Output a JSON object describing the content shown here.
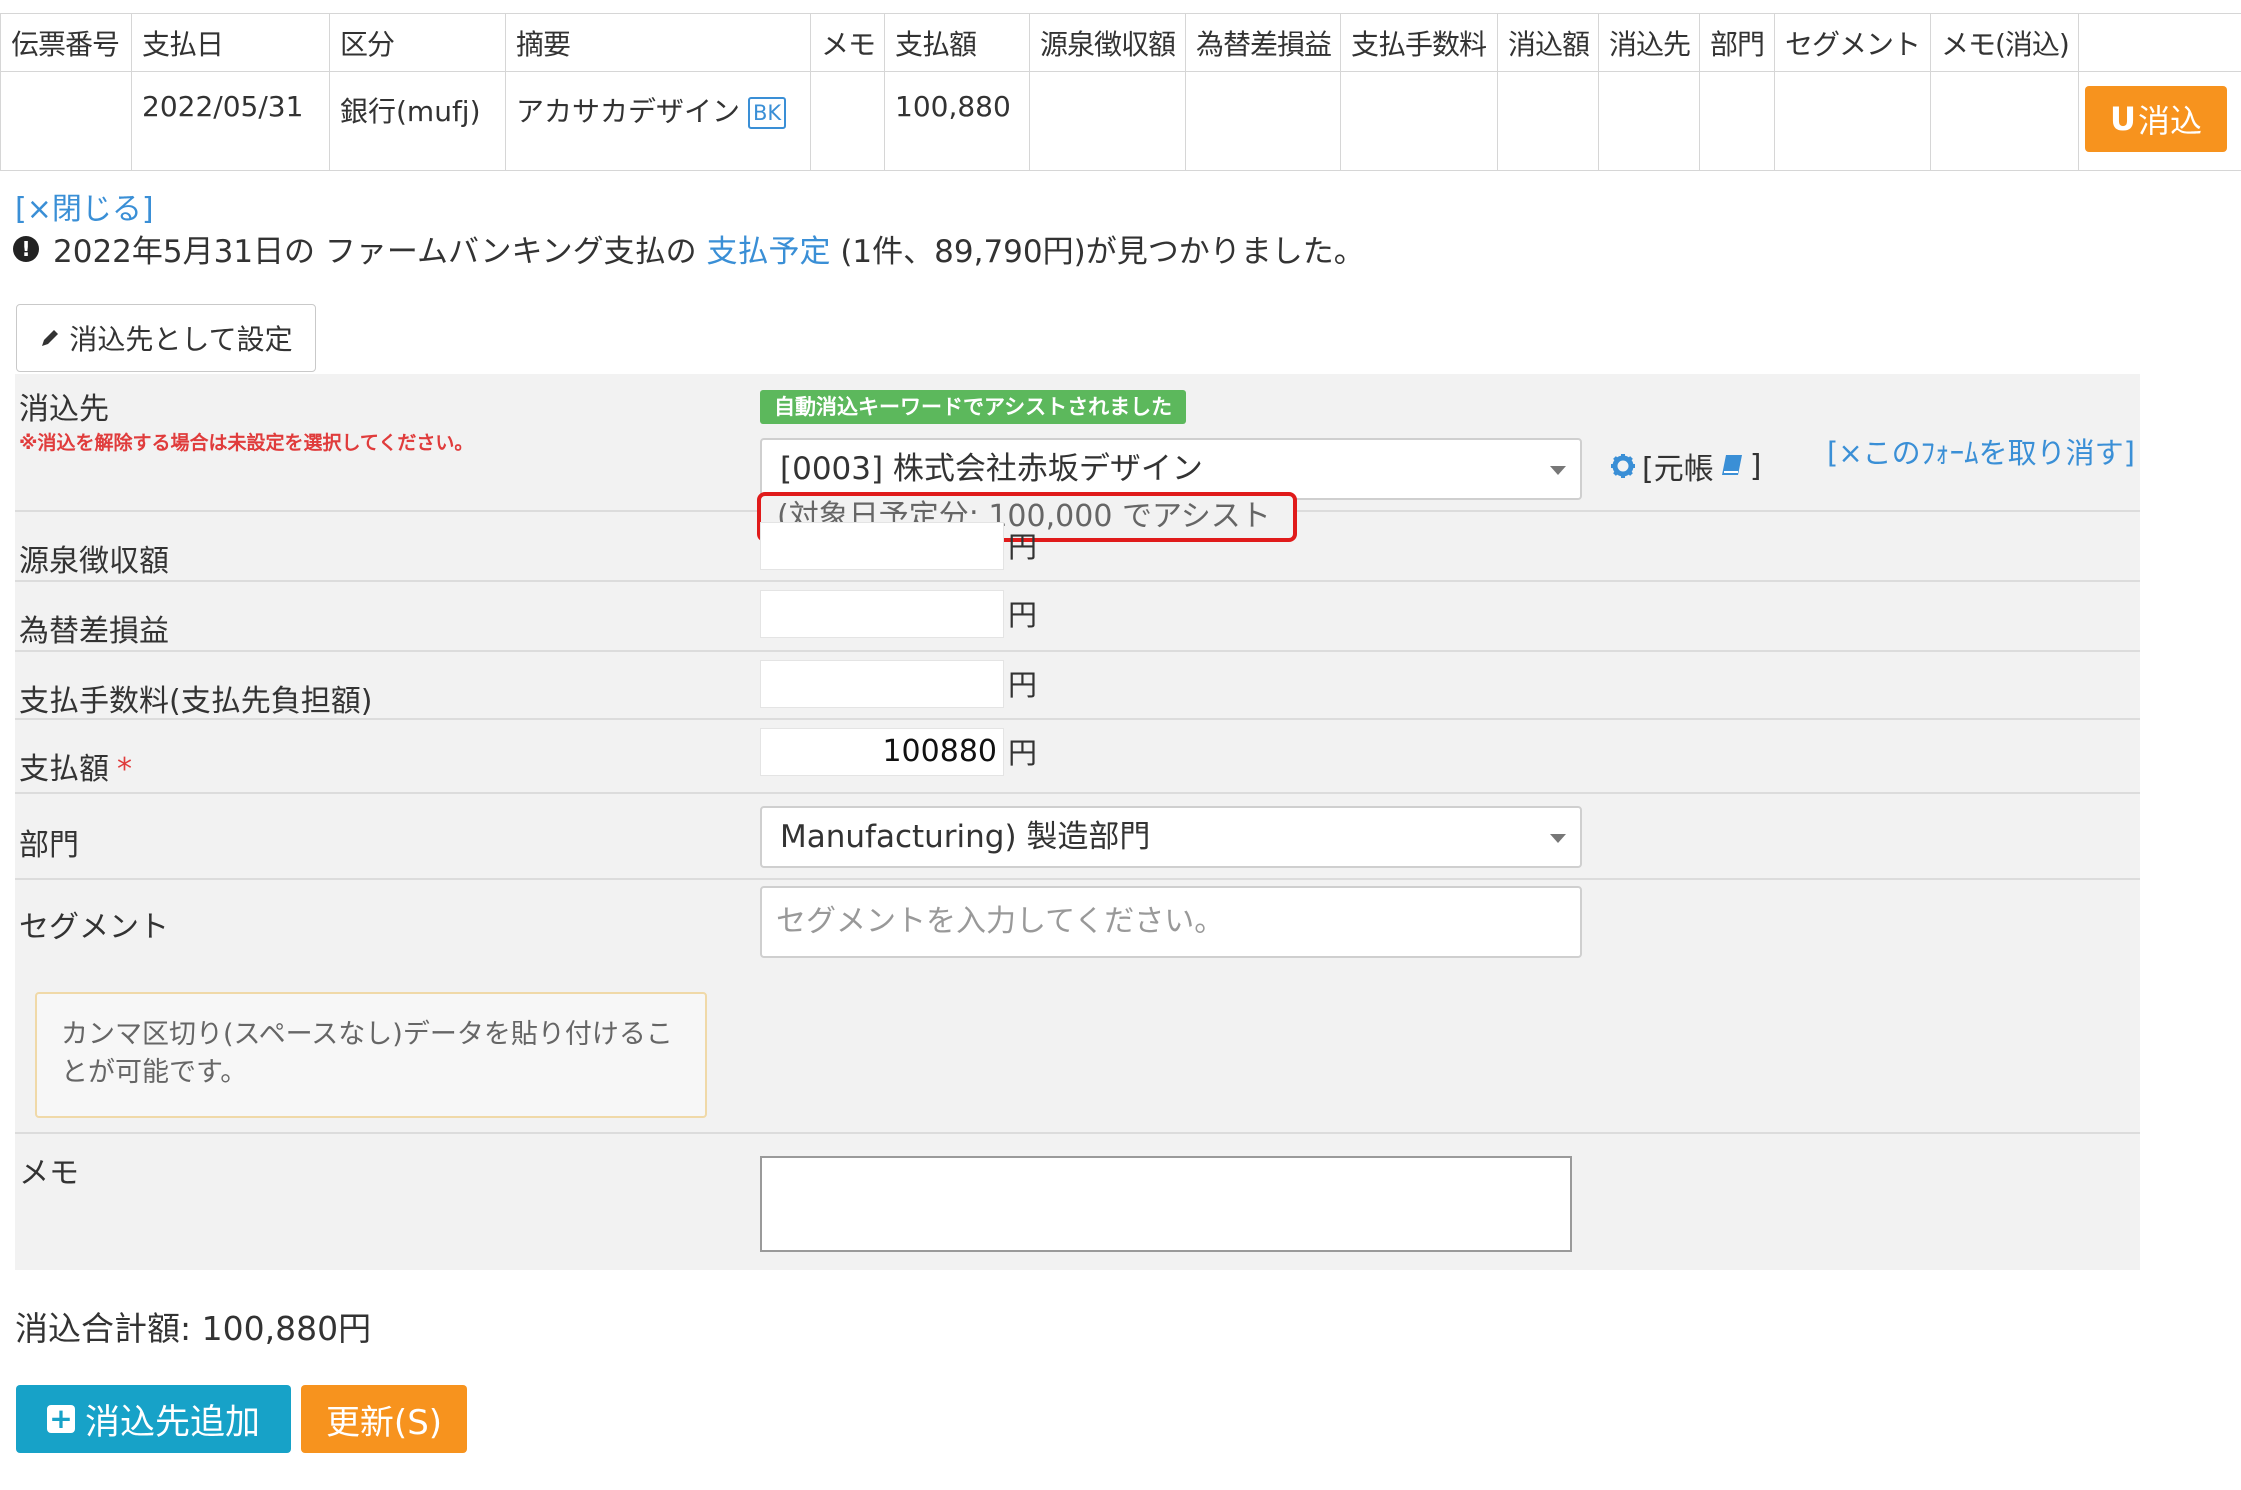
{
  "table": {
    "headers": [
      "伝票番号",
      "支払日",
      "区分",
      "摘要",
      "メモ",
      "支払額",
      "源泉徴収額",
      "為替差損益",
      "支払手数料",
      "消込額",
      "消込先",
      "部門",
      "セグメント",
      "メモ(消込)",
      ""
    ],
    "row": {
      "voucher_no": "",
      "pay_date": "2022/05/31",
      "category": "銀行(mufj)",
      "description": "アカサカデザイン",
      "description_badge": "BK",
      "memo": "",
      "amount": "100,880"
    },
    "reconcile_button": "消込",
    "reconcile_icon": "U"
  },
  "close_link": "[×閉じる]",
  "notice": {
    "icon": "!",
    "text_before": "2022年5月31日の ファームバンキング支払の ",
    "link": "支払予定",
    "text_after": " (1件、89,790円)が見つかりました。"
  },
  "set_target_button": "消込先として設定",
  "set_target_icon": "pencil-icon",
  "form": {
    "target": {
      "label": "消込先",
      "warning": "※消込を解除する場合は未設定を選択してください。",
      "badge": "自動消込キーワードでアシストされました",
      "selected": "[0003] 株式会社赤坂デザイン",
      "ledger_open": "[元帳",
      "ledger_close": "]",
      "cancel_form": "[×このﾌｫｰﾑを取り消す]",
      "assist_note": "(対象日予定分: 100,000 でアシスト"
    },
    "withholding": {
      "label": "源泉徴収額",
      "value": "",
      "unit": "円"
    },
    "fx": {
      "label": "為替差損益",
      "value": "",
      "unit": "円"
    },
    "fee": {
      "label": "支払手数料(支払先負担額)",
      "value": "",
      "unit": "円"
    },
    "amount": {
      "label": "支払額",
      "required": "*",
      "value": "100880",
      "unit": "円"
    },
    "department": {
      "label": "部門",
      "selected": "Manufacturing) 製造部門"
    },
    "segment": {
      "label": "セグメント",
      "placeholder": "セグメントを入力してください。",
      "help": "カンマ区切り(スペースなし)データを貼り付けることが可能です。"
    },
    "memo": {
      "label": "メモ",
      "value": ""
    }
  },
  "footer": {
    "total": "消込合計額: 100,880円",
    "add_target_button": "消込先追加",
    "update_button": "更新(S)"
  },
  "colors": {
    "link": "#3a8fd6",
    "orange": "#f7931e",
    "teal": "#17a2c8",
    "green": "#5cb85c",
    "highlight_red": "#e01b1b"
  }
}
